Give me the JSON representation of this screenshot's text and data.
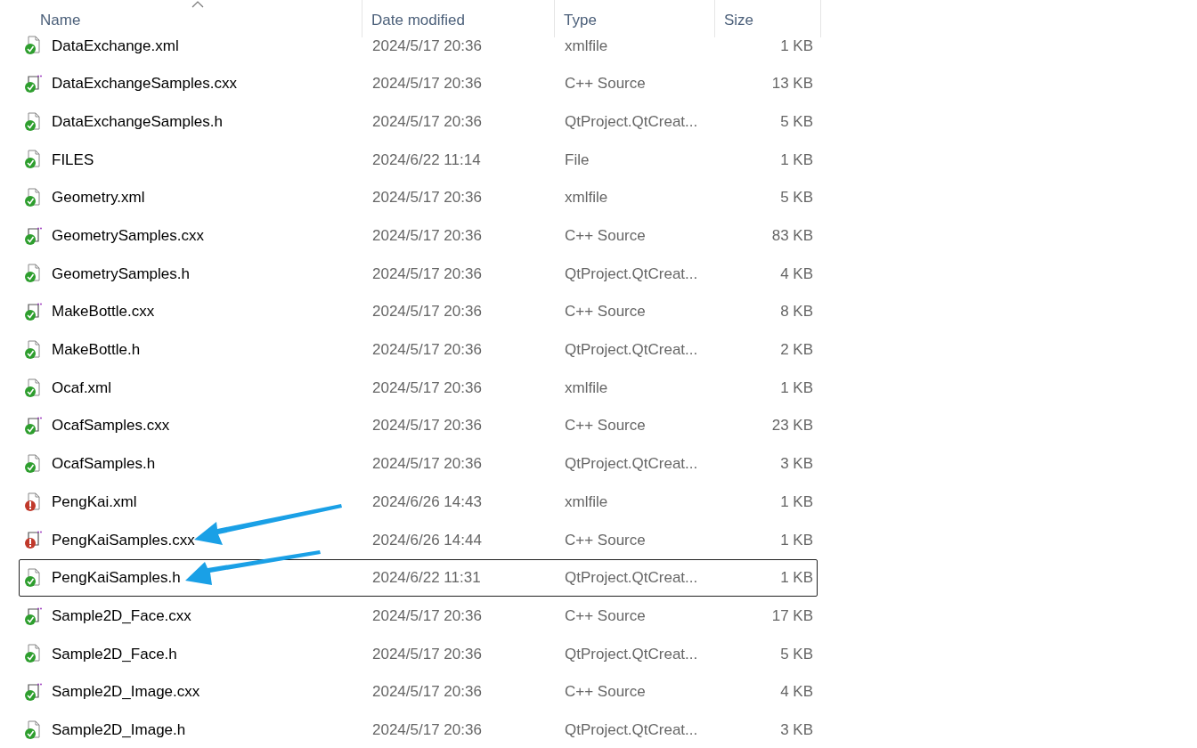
{
  "columns": [
    {
      "label": "Name",
      "sorted": true
    },
    {
      "label": "Date modified",
      "sorted": false
    },
    {
      "label": "Type",
      "sorted": false
    },
    {
      "label": "Size",
      "sorted": false
    }
  ],
  "rows": [
    {
      "name": "DataExchange.xml",
      "date": "2024/5/17 20:36",
      "type": "xmlfile",
      "size": "1 KB",
      "kind": "file",
      "error": false,
      "selected": false
    },
    {
      "name": "DataExchangeSamples.cxx",
      "date": "2024/5/17 20:36",
      "type": "C++ Source",
      "size": "13 KB",
      "kind": "cpp",
      "error": false,
      "selected": false
    },
    {
      "name": "DataExchangeSamples.h",
      "date": "2024/5/17 20:36",
      "type": "QtProject.QtCreat...",
      "size": "5 KB",
      "kind": "file",
      "error": false,
      "selected": false
    },
    {
      "name": "FILES",
      "date": "2024/6/22 11:14",
      "type": "File",
      "size": "1 KB",
      "kind": "file",
      "error": false,
      "selected": false
    },
    {
      "name": "Geometry.xml",
      "date": "2024/5/17 20:36",
      "type": "xmlfile",
      "size": "5 KB",
      "kind": "file",
      "error": false,
      "selected": false
    },
    {
      "name": "GeometrySamples.cxx",
      "date": "2024/5/17 20:36",
      "type": "C++ Source",
      "size": "83 KB",
      "kind": "cpp",
      "error": false,
      "selected": false
    },
    {
      "name": "GeometrySamples.h",
      "date": "2024/5/17 20:36",
      "type": "QtProject.QtCreat...",
      "size": "4 KB",
      "kind": "file",
      "error": false,
      "selected": false
    },
    {
      "name": "MakeBottle.cxx",
      "date": "2024/5/17 20:36",
      "type": "C++ Source",
      "size": "8 KB",
      "kind": "cpp",
      "error": false,
      "selected": false
    },
    {
      "name": "MakeBottle.h",
      "date": "2024/5/17 20:36",
      "type": "QtProject.QtCreat...",
      "size": "2 KB",
      "kind": "file",
      "error": false,
      "selected": false
    },
    {
      "name": "Ocaf.xml",
      "date": "2024/5/17 20:36",
      "type": "xmlfile",
      "size": "1 KB",
      "kind": "file",
      "error": false,
      "selected": false
    },
    {
      "name": "OcafSamples.cxx",
      "date": "2024/5/17 20:36",
      "type": "C++ Source",
      "size": "23 KB",
      "kind": "cpp",
      "error": false,
      "selected": false
    },
    {
      "name": "OcafSamples.h",
      "date": "2024/5/17 20:36",
      "type": "QtProject.QtCreat...",
      "size": "3 KB",
      "kind": "file",
      "error": false,
      "selected": false
    },
    {
      "name": "PengKai.xml",
      "date": "2024/6/26 14:43",
      "type": "xmlfile",
      "size": "1 KB",
      "kind": "file",
      "error": true,
      "selected": false
    },
    {
      "name": "PengKaiSamples.cxx",
      "date": "2024/6/26 14:44",
      "type": "C++ Source",
      "size": "1 KB",
      "kind": "cpp",
      "error": true,
      "selected": false
    },
    {
      "name": "PengKaiSamples.h",
      "date": "2024/6/22 11:31",
      "type": "QtProject.QtCreat...",
      "size": "1 KB",
      "kind": "file",
      "error": false,
      "selected": true
    },
    {
      "name": "Sample2D_Face.cxx",
      "date": "2024/5/17 20:36",
      "type": "C++ Source",
      "size": "17 KB",
      "kind": "cpp",
      "error": false,
      "selected": false
    },
    {
      "name": "Sample2D_Face.h",
      "date": "2024/5/17 20:36",
      "type": "QtProject.QtCreat...",
      "size": "5 KB",
      "kind": "file",
      "error": false,
      "selected": false
    },
    {
      "name": "Sample2D_Image.cxx",
      "date": "2024/5/17 20:36",
      "type": "C++ Source",
      "size": "4 KB",
      "kind": "cpp",
      "error": false,
      "selected": false
    },
    {
      "name": "Sample2D_Image.h",
      "date": "2024/5/17 20:36",
      "type": "QtProject.QtCreat...",
      "size": "3 KB",
      "kind": "file",
      "error": false,
      "selected": false
    }
  ]
}
